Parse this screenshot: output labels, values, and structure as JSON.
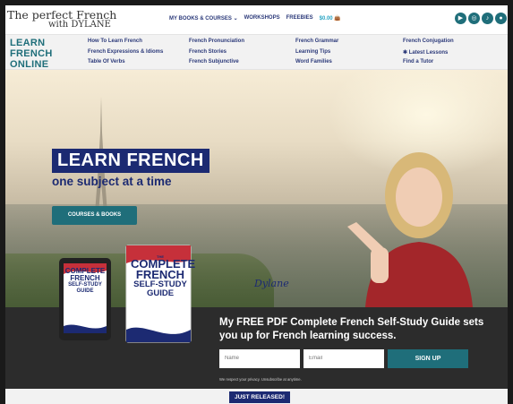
{
  "logo": {
    "line1": "The perfect French",
    "line2": "with DYLANE"
  },
  "topnav": {
    "books_courses": "MY BOOKS & COURSES ⌄",
    "workshops": "WORKSHOPS",
    "freebies": "FREEBIES",
    "cart": "$0.00 👜"
  },
  "social": [
    "youtube-icon",
    "instagram-icon",
    "tiktok-icon",
    "account-icon"
  ],
  "subnav": {
    "brand": [
      "LEARN",
      "FRENCH",
      "ONLINE"
    ],
    "links": [
      "How To Learn French",
      "French Pronunciation",
      "French Grammar",
      "French Conjugation",
      "French Expressions & Idioms",
      "French Stories",
      "Learning Tips",
      "✱ Latest Lessons",
      "Table Of Verbs",
      "French Subjunctive",
      "Word Families",
      "Find a Tutor"
    ]
  },
  "hero": {
    "title": "LEARN FRENCH",
    "subtitle": "one subject at a time",
    "cta": "COURSES & BOOKS",
    "signature": "Dylane"
  },
  "book": {
    "title_lines": [
      "COMPLETE",
      "FRENCH",
      "SELF-STUDY",
      "GUIDE"
    ],
    "label": "THE"
  },
  "signup": {
    "headline": "My FREE PDF Complete French Self-Study Guide sets you up for French learning success.",
    "name_placeholder": "Name",
    "email_placeholder": "Email",
    "button": "SIGN UP",
    "privacy": "We respect your privacy. Unsubscribe at anytime."
  },
  "badge": "JUST RELEASED!",
  "colors": {
    "teal": "#1f6e7a",
    "navy": "#1c2a72",
    "dark": "#2c2c2c"
  }
}
